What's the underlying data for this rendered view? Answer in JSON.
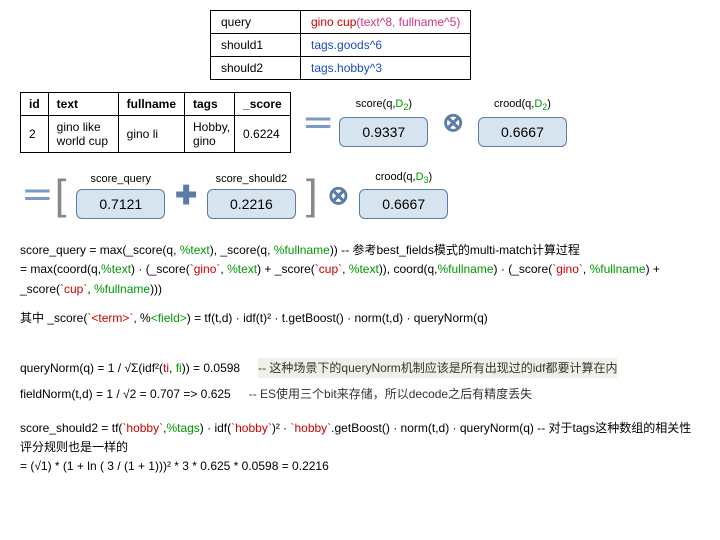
{
  "query_table": {
    "rows": [
      {
        "k": "query",
        "v_prefix": "gino cup",
        "v_suffix": "(text^8, fullname^5)"
      },
      {
        "k": "should1",
        "v": "tags.goods^6"
      },
      {
        "k": "should2",
        "v": "tags.hobby^3"
      }
    ]
  },
  "doc_table": {
    "headers": [
      "id",
      "text",
      "fullname",
      "tags",
      "_score"
    ],
    "row": {
      "id": "2",
      "text": "gino like world cup",
      "fullname": "gino li",
      "tags": "Hobby, gino",
      "score": "0.6224"
    }
  },
  "boxes": {
    "score_q_D2_label_pre": "score(q,",
    "D2": "D",
    "D2_sub": "2",
    "score_q_D2_val": "0.9337",
    "crood_q_D2_label_pre": "crood(q,",
    "crood_q_D2_val": "0.6667",
    "score_query_label": "score_query",
    "score_query_val": "0.7121",
    "score_should2_label": "score_should2",
    "score_should2_val": "0.2216",
    "crood_q_D3_label_pre": "crood(q,",
    "D3_sub": "3",
    "crood_q_D3_val": "0.6667"
  },
  "formula1": {
    "l1a": "score_query = max(_score(q, ",
    "l1b": "%text",
    "l1c": "), _score(q, ",
    "l1d": "%fullname",
    "l1e": "))    -- 参考best_fields模式的multi-match计算过程",
    "l2a": "=  max(coord(q,",
    "l2b": "%text",
    "l2c": ") · (_score(",
    "l2d": "`gino`",
    "l2e": ", ",
    "l2f": "%text",
    "l2g": ") + _score(",
    "l2h": "`cup`",
    "l2i": ", ",
    "l2j": "%text",
    "l2k": ")), coord(q,",
    "l2l": "%fullname",
    "l2m": ") · (_score(",
    "l2n": "`gino`",
    "l2o": ", ",
    "l2p": "%fullname",
    "l2q": ") + _score(",
    "l2r": "`cup`",
    "l2s": ", ",
    "l2t": "%fullname",
    "l2u": ")))",
    "l3a": "其中 _score(",
    "l3b": "`<term>`",
    "l3c": ", %",
    "l3d": "<field>",
    "l3e": ") = tf(t,d) · idf(t)² · t.getBoost() · norm(t,d) · queryNorm(q)"
  },
  "formula2": {
    "lhs1a": "queryNorm(q) = 1 / √Σ(idf²(",
    "lhs1b": "ti",
    "lhs1c": ", ",
    "lhs1d": "fi",
    "lhs1e": ")) = 0.0598",
    "rhs1": "-- 这种场景下的queryNorm机制应该是所有出现过的idf都要计算在内",
    "lhs2": "fieldNorm(t,d) = 1 / √2 = 0.707 => 0.625",
    "rhs2": "-- ES使用三个bit来存储，所以decode之后有精度丢失"
  },
  "formula3": {
    "l1a": "score_should2 =  tf(",
    "l1b": "`hobby`",
    "l1c": ",",
    "l1d": "%tags",
    "l1e": ") · idf(",
    "l1f": "`hobby`",
    "l1g": ")² · ",
    "l1h": "`hobby`",
    "l1i": ".getBoost() · norm(t,d) · queryNorm(q)   -- 对于tags这种数组的相关性评分规则也是一样的",
    "l2": " = (√1) * (1 + ln ( 3 / (1 + 1)))² * 3 * 0.625 * 0.0598 = 0.2216"
  }
}
